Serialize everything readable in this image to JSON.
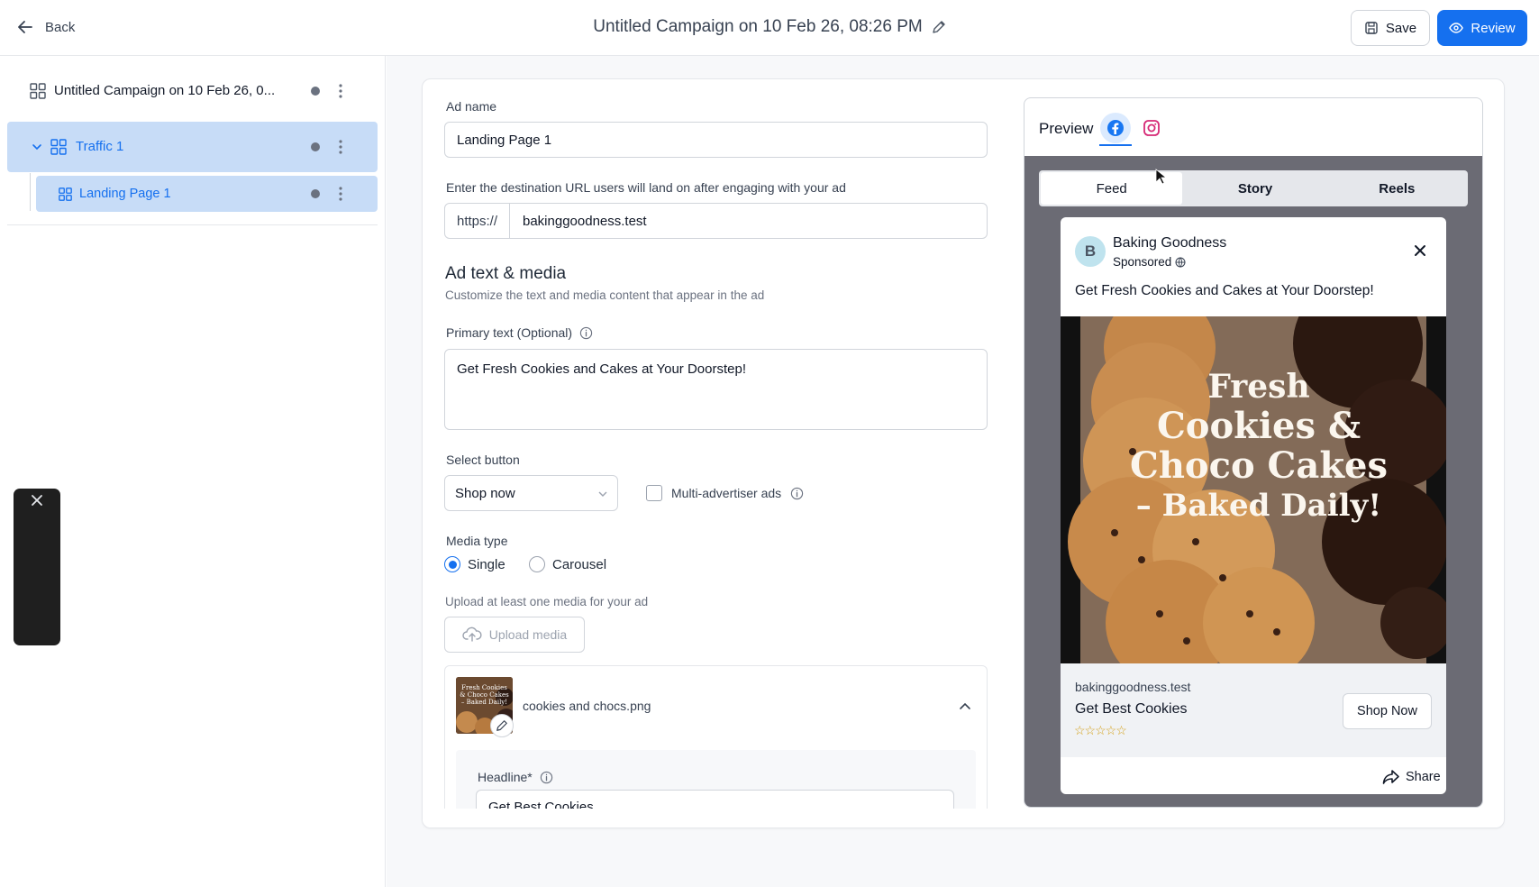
{
  "header": {
    "back_label": "Back",
    "title": "Untitled Campaign on 10 Feb 26, 08:26 PM",
    "save_label": "Save",
    "review_label": "Review"
  },
  "sidebar": {
    "campaign_label": "Untitled Campaign on 10 Feb 26, 0...",
    "adset_label": "Traffic 1",
    "ad_label": "Landing Page 1"
  },
  "form": {
    "ad_name_label": "Ad name",
    "ad_name_value": "Landing Page 1",
    "url_label": "Enter the destination URL users will land on after engaging with your ad",
    "url_prefix": "https://",
    "url_value": "bakinggoodness.test",
    "section_title": "Ad text & media",
    "section_sub": "Customize the text and media content that appear in the ad",
    "primary_text_label": "Primary text (Optional)",
    "primary_text_value": "Get Fresh Cookies and Cakes at Your Doorstep!",
    "select_button_label": "Select button",
    "select_button_value": "Shop now",
    "multi_advertiser_label": "Multi-advertiser ads",
    "media_type_label": "Media type",
    "media_single": "Single",
    "media_carousel": "Carousel",
    "upload_hint": "Upload at least one media for your ad",
    "upload_label": "Upload media",
    "file_name": "cookies and chocs.png",
    "headline_label": "Headline*",
    "headline_value": "Get Best Cookies"
  },
  "preview": {
    "title": "Preview",
    "tabs": [
      "Feed",
      "Story",
      "Reels"
    ],
    "page_name": "Baking Goodness",
    "avatar_letter": "B",
    "sponsored": "Sponsored",
    "post_text": "Get Fresh Cookies and Cakes at Your Doorstep!",
    "image_text_1": "Fresh",
    "image_text_2": "Cookies &",
    "image_text_3": "Choco Cakes",
    "image_text_4": "– Baked Daily!",
    "thumb_text": "Fresh Cookies & Choco Cakes – Baked Daily!",
    "domain": "bakinggoodness.test",
    "headline": "Get Best Cookies",
    "stars": "☆☆☆☆☆",
    "cta": "Shop Now",
    "share": "Share"
  },
  "colors": {
    "primary": "#1570ef",
    "selected_row": "#c7dcf7",
    "preview_bg": "#6b6b74"
  }
}
